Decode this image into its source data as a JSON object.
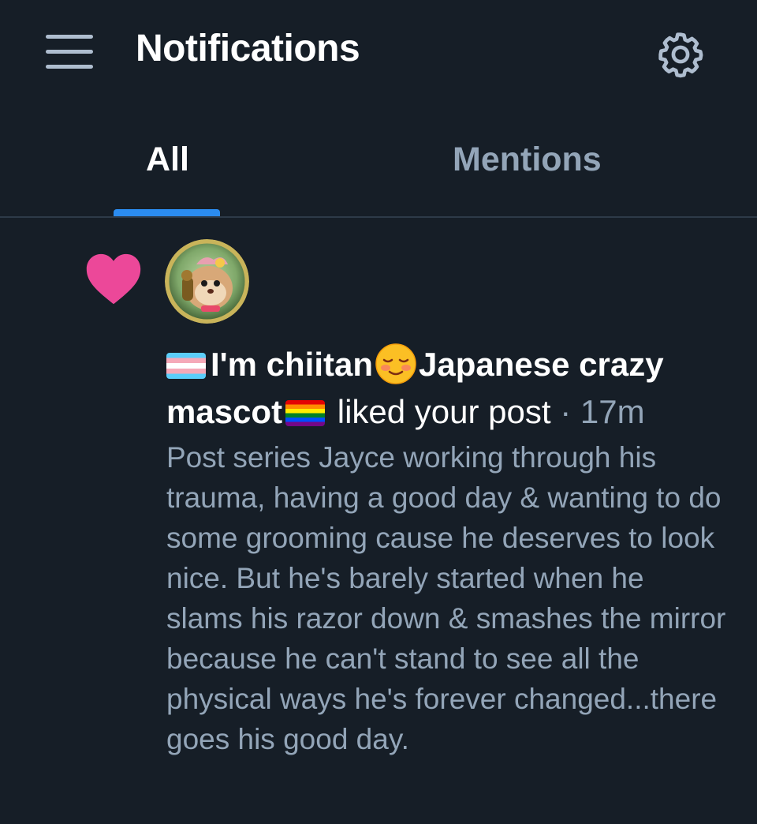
{
  "header": {
    "title": "Notifications",
    "menu_icon": "hamburger-menu-icon",
    "settings_icon": "gear-icon"
  },
  "tabs": [
    {
      "label": "All",
      "active": true
    },
    {
      "label": "Mentions",
      "active": false
    }
  ],
  "colors": {
    "background": "#161e27",
    "accent": "#2b8cf0",
    "like": "#ec4899",
    "muted_text": "#93a5b8"
  },
  "notification": {
    "type_icon": "heart-icon",
    "user_name": "I'm chiitan",
    "user_name_rest": "Japanese crazy mascot",
    "action": "liked your post",
    "separator": "·",
    "time": "17m",
    "post_text": "Post series Jayce working through his trauma, having a good day & wanting to do some grooming cause he deserves to look nice. But he's barely started when he slams his razor down & smashes the mirror because he can't stand to see all the physical ways he's forever changed...there goes his good day."
  }
}
